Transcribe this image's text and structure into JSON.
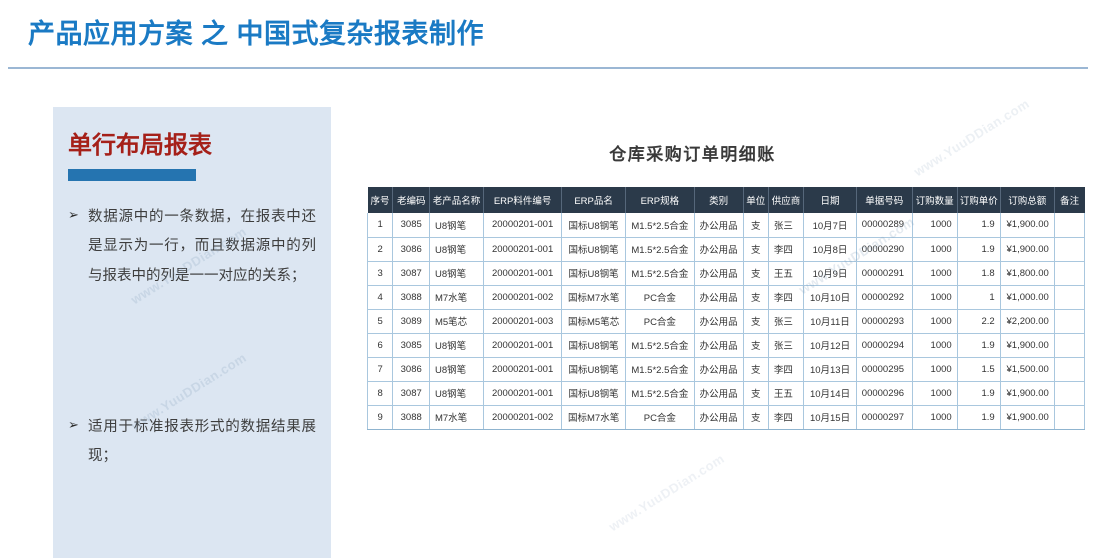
{
  "header": {
    "title": "产品应用方案 之 中国式复杂报表制作",
    "accent_color": "#1a7ac4",
    "divider_color": "#9bb7d4"
  },
  "info_panel": {
    "heading": "单行布局报表",
    "heading_color": "#a52019",
    "panel_bg": "#dce6f2",
    "accent_bar_color": "#2574b0",
    "bullet_marker": "➢",
    "bullets": [
      "数据源中的一条数据，在报表中还是显示为一行，而且数据源中的列与报表中的列是一一对应的关系；",
      "适用于标准报表形式的数据结果展现；"
    ]
  },
  "report": {
    "title": "仓库采购订单明细账",
    "header_bg": "#2b3a4a",
    "grid_color": "#a9c7de",
    "columns": [
      {
        "label": "序号",
        "width": 30,
        "align": "c-center"
      },
      {
        "label": "老编码",
        "width": 44,
        "align": "c-center"
      },
      {
        "label": "老产品名称",
        "width": 58,
        "align": "c-left"
      },
      {
        "label": "ERP料件编号",
        "width": 92,
        "align": "c-center"
      },
      {
        "label": "ERP品名",
        "width": 68,
        "align": "c-center"
      },
      {
        "label": "ERP规格",
        "width": 70,
        "align": "c-center"
      },
      {
        "label": "类别",
        "width": 48,
        "align": "c-center"
      },
      {
        "label": "单位",
        "width": 28,
        "align": "c-center"
      },
      {
        "label": "供应商",
        "width": 40,
        "align": "c-left"
      },
      {
        "label": "日期",
        "width": 56,
        "align": "c-center"
      },
      {
        "label": "单据号码",
        "width": 62,
        "align": "c-left"
      },
      {
        "label": "订购数量",
        "width": 50,
        "align": "c-right"
      },
      {
        "label": "订购单价",
        "width": 42,
        "align": "c-right"
      },
      {
        "label": "订购总额",
        "width": 56,
        "align": "c-right"
      },
      {
        "label": "备注",
        "width": 46,
        "align": "c-center"
      }
    ],
    "rows": [
      [
        "1",
        "3085",
        "U8钢笔",
        "20000201-001",
        "国标U8钢笔",
        "M1.5*2.5合金",
        "办公用品",
        "支",
        "张三",
        "10月7日",
        "00000289",
        "1000",
        "1.9",
        "¥1,900.00",
        ""
      ],
      [
        "2",
        "3086",
        "U8钢笔",
        "20000201-001",
        "国标U8钢笔",
        "M1.5*2.5合金",
        "办公用品",
        "支",
        "李四",
        "10月8日",
        "00000290",
        "1000",
        "1.9",
        "¥1,900.00",
        ""
      ],
      [
        "3",
        "3087",
        "U8钢笔",
        "20000201-001",
        "国标U8钢笔",
        "M1.5*2.5合金",
        "办公用品",
        "支",
        "王五",
        "10月9日",
        "00000291",
        "1000",
        "1.8",
        "¥1,800.00",
        ""
      ],
      [
        "4",
        "3088",
        "M7水笔",
        "20000201-002",
        "国标M7水笔",
        "PC合金",
        "办公用品",
        "支",
        "李四",
        "10月10日",
        "00000292",
        "1000",
        "1",
        "¥1,000.00",
        ""
      ],
      [
        "5",
        "3089",
        "M5笔芯",
        "20000201-003",
        "国标M5笔芯",
        "PC合金",
        "办公用品",
        "支",
        "张三",
        "10月11日",
        "00000293",
        "1000",
        "2.2",
        "¥2,200.00",
        ""
      ],
      [
        "6",
        "3085",
        "U8钢笔",
        "20000201-001",
        "国标U8钢笔",
        "M1.5*2.5合金",
        "办公用品",
        "支",
        "张三",
        "10月12日",
        "00000294",
        "1000",
        "1.9",
        "¥1,900.00",
        ""
      ],
      [
        "7",
        "3086",
        "U8钢笔",
        "20000201-001",
        "国标U8钢笔",
        "M1.5*2.5合金",
        "办公用品",
        "支",
        "李四",
        "10月13日",
        "00000295",
        "1000",
        "1.5",
        "¥1,500.00",
        ""
      ],
      [
        "8",
        "3087",
        "U8钢笔",
        "20000201-001",
        "国标U8钢笔",
        "M1.5*2.5合金",
        "办公用品",
        "支",
        "王五",
        "10月14日",
        "00000296",
        "1000",
        "1.9",
        "¥1,900.00",
        ""
      ],
      [
        "9",
        "3088",
        "M7水笔",
        "20000201-002",
        "国标M7水笔",
        "PC合金",
        "办公用品",
        "支",
        "李四",
        "10月15日",
        "00000297",
        "1000",
        "1.9",
        "¥1,900.00",
        ""
      ]
    ]
  },
  "watermarks": [
    "www.YuuDDian.com",
    "www.YuuDDian.com",
    "www.YuuDDian.com",
    "www.YuuDDian.com",
    "www.YuuDDian.com"
  ]
}
